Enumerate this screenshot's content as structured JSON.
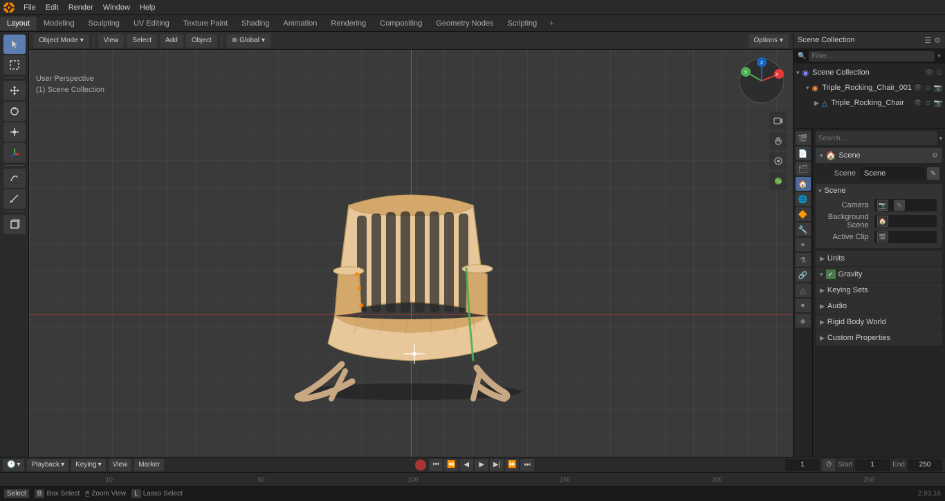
{
  "app": {
    "title": "Blender",
    "version": "2.93.16"
  },
  "menu": {
    "items": [
      "File",
      "Edit",
      "Render",
      "Window",
      "Help"
    ]
  },
  "workspace_tabs": {
    "items": [
      "Layout",
      "Modeling",
      "Sculpting",
      "UV Editing",
      "Texture Paint",
      "Shading",
      "Animation",
      "Rendering",
      "Compositing",
      "Geometry Nodes",
      "Scripting"
    ],
    "active": "Layout"
  },
  "viewport_header": {
    "mode": "Object Mode",
    "view": "View",
    "select": "Select",
    "add": "Add",
    "object": "Object",
    "transform": "Global",
    "options_btn": "Options"
  },
  "view_info": {
    "perspective": "User Perspective",
    "collection": "(1) Scene Collection"
  },
  "left_tools": {
    "tools": [
      "cursor",
      "move",
      "rotate",
      "scale",
      "transform",
      "annotate",
      "measure",
      "add-cube"
    ]
  },
  "outliner": {
    "title": "Scene Collection",
    "items": [
      {
        "name": "Triple_Rocking_Chair_001",
        "indent": 1,
        "hasChildren": true,
        "type": "collection"
      },
      {
        "name": "Triple_Rocking_Chair",
        "indent": 2,
        "hasChildren": false,
        "type": "mesh"
      }
    ]
  },
  "properties": {
    "tabs": [
      "render",
      "output",
      "view_layer",
      "scene",
      "world",
      "object",
      "modifier",
      "particles",
      "physics",
      "constraints",
      "object_data",
      "material",
      "shader_nodes"
    ],
    "active_tab": "scene",
    "scene_panel": {
      "header": "Scene",
      "camera_label": "Camera",
      "camera_value": "",
      "background_scene_label": "Background Scene",
      "active_clip_label": "Active Clip"
    },
    "sections": [
      {
        "label": "Units",
        "collapsed": true
      },
      {
        "label": "Gravity",
        "collapsed": false,
        "checkbox": true
      },
      {
        "label": "Keying Sets",
        "collapsed": true
      },
      {
        "label": "Audio",
        "collapsed": true
      },
      {
        "label": "Rigid Body World",
        "collapsed": true
      },
      {
        "label": "Custom Properties",
        "collapsed": true
      }
    ]
  },
  "timeline": {
    "playback_label": "Playback",
    "keying_label": "Keying",
    "view_label": "View",
    "marker_label": "Marker",
    "frame_current": "1",
    "start_label": "Start",
    "start_value": "1",
    "end_label": "End",
    "end_value": "250"
  },
  "frame_numbers": [
    "10",
    "50",
    "100",
    "150",
    "200",
    "250"
  ],
  "status_bar": {
    "select_label": "Select",
    "box_select_label": "Box Select",
    "zoom_view_label": "Zoom View",
    "lasso_select_label": "Lasso Select",
    "version": "2.93.16"
  }
}
